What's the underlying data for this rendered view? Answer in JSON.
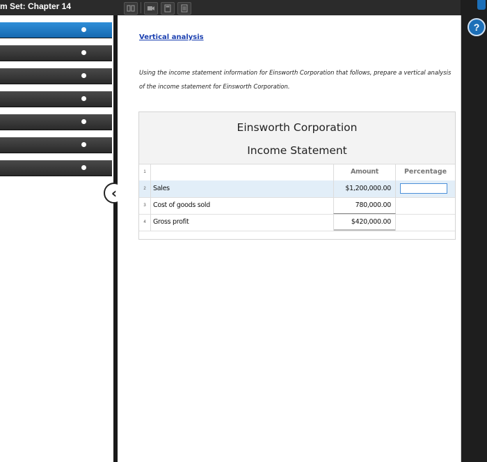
{
  "header": {
    "title": "m Set: Chapter 14",
    "toolbar_icons": [
      "book-icon",
      "video-icon",
      "calculator-icon",
      "document-icon"
    ]
  },
  "nav": {
    "items_count": 7,
    "active_index": 0
  },
  "main": {
    "link_title": "Vertical analysis",
    "instructions": "Using the income statement information for Einsworth Corporation that follows, prepare a vertical analysis of the income statement for Einsworth Corporation.",
    "sheet": {
      "company": "Einsworth Corporation",
      "statement": "Income Statement",
      "header_row": {
        "num": "1",
        "amount": "Amount",
        "percentage": "Percentage"
      },
      "rows": [
        {
          "num": "2",
          "label": "Sales",
          "amount": "$1,200,000.00",
          "percentage": ""
        },
        {
          "num": "3",
          "label": "Cost of goods sold",
          "amount": "780,000.00",
          "percentage": ""
        },
        {
          "num": "4",
          "label": "Gross profit",
          "amount": "$420,000.00",
          "percentage": ""
        }
      ]
    }
  },
  "sidebar": {
    "help_label": "?"
  },
  "colors": {
    "active_nav": "#1c6fb8",
    "link": "#1a3fb0",
    "selected_row": "#e2eef8"
  }
}
